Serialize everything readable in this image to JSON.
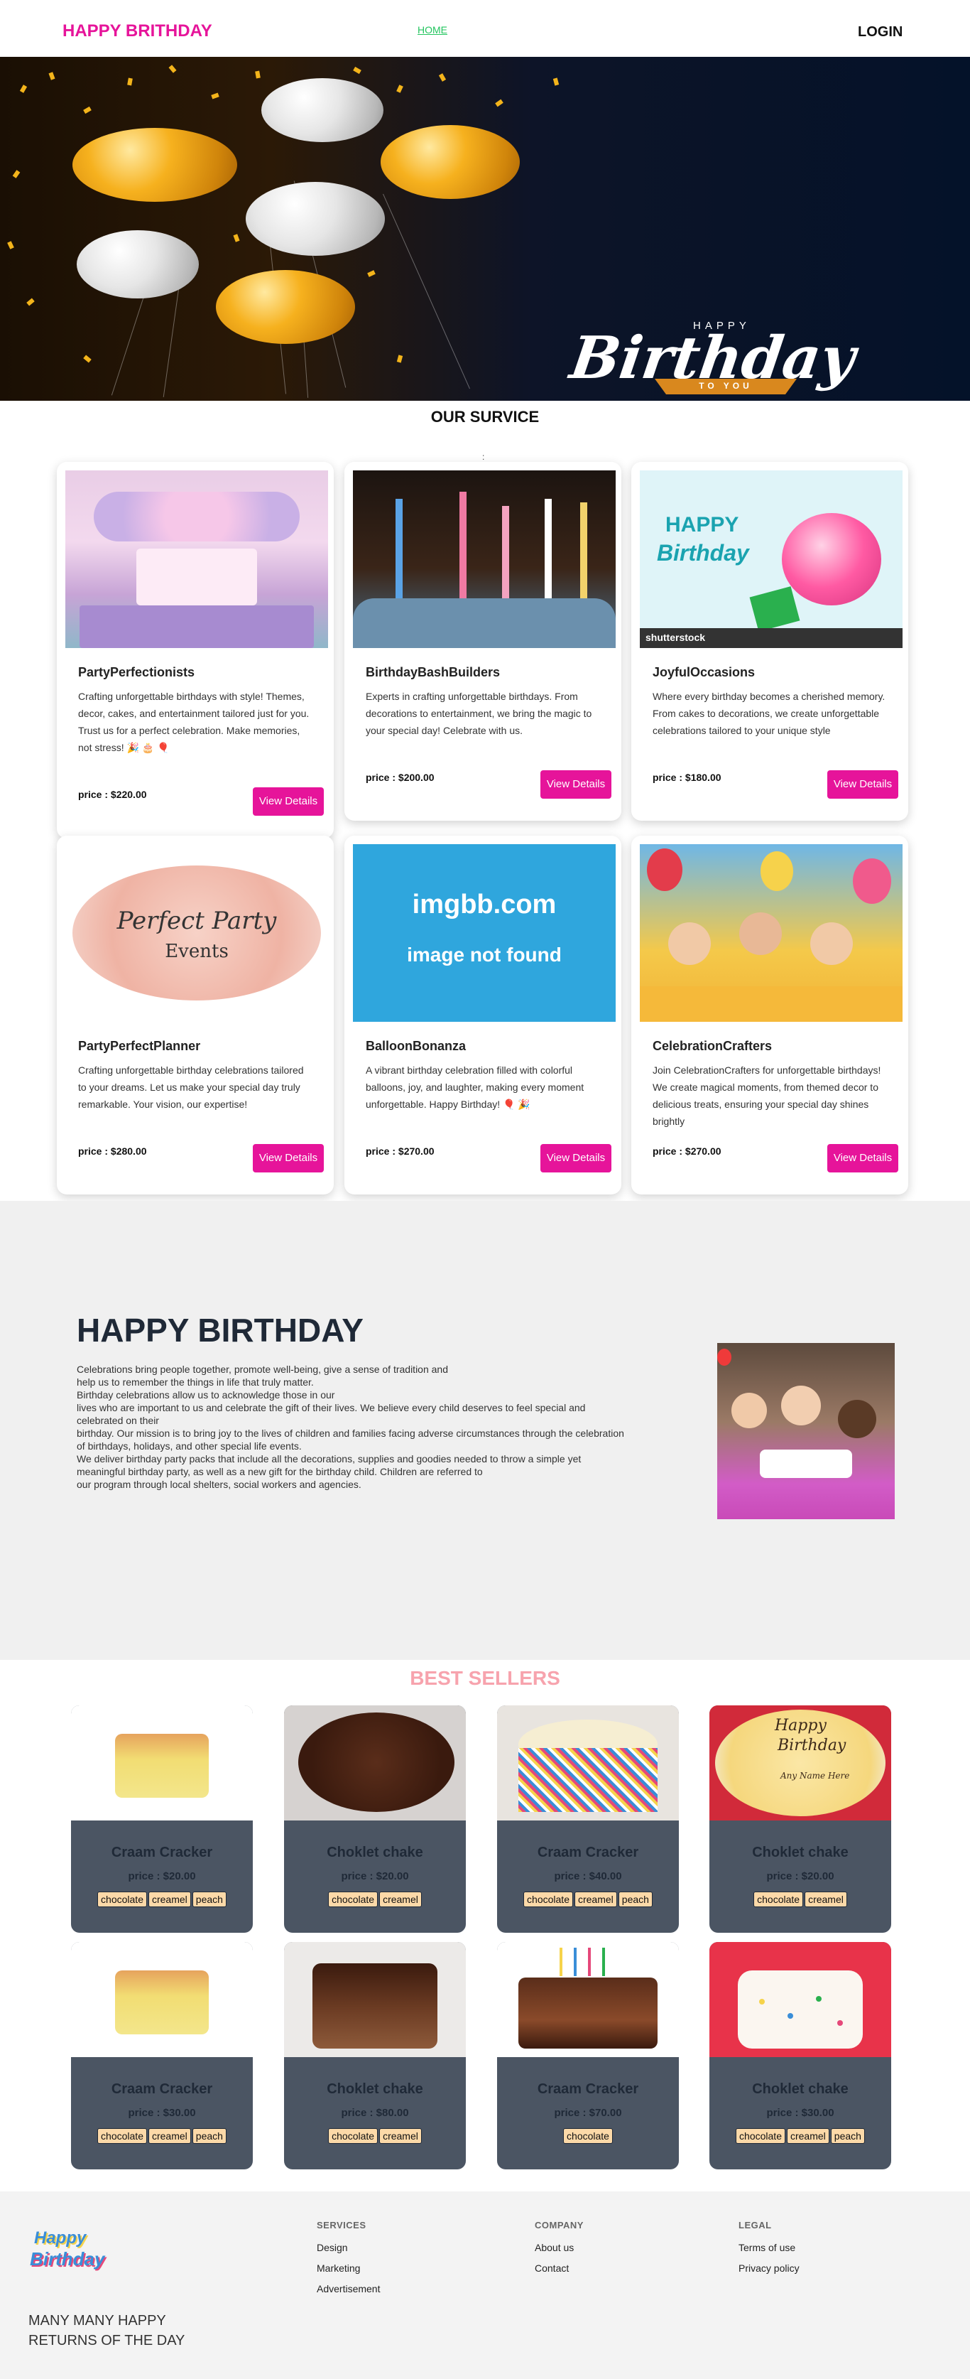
{
  "nav": {
    "brand": "HAPPY BRITHDAY",
    "home": "HOME",
    "login": "LOGIN"
  },
  "hero": {
    "happy": "HAPPY",
    "script": "Birthday",
    "to_you": "TO YOU"
  },
  "services": {
    "title": "OUR SURVICE",
    "dots": ":",
    "cards": [
      {
        "title": "PartyPerfectionists",
        "desc": "Crafting unforgettable birthdays with style! Themes, decor, cakes, and entertainment tailored just for you. Trust us for a perfect celebration. Make memories, not stress! 🎉 🎂 🎈",
        "price": "price : $220.00",
        "button": "View Details"
      },
      {
        "title": "BirthdayBashBuilders",
        "desc": "Experts in crafting unforgettable birthdays. From decorations to entertainment, we bring the magic to your special day! Celebrate with us.",
        "price": "price : $200.00",
        "button": "View Details"
      },
      {
        "title": "JoyfulOccasions",
        "desc": "Where every birthday becomes a cherished memory. From cakes to decorations, we create unforgettable celebrations tailored to your unique style",
        "price": "price : $180.00",
        "button": "View Details"
      },
      {
        "title": "PartyPerfectPlanner",
        "desc": "Crafting unforgettable birthday celebrations tailored to your dreams. Let us make your special day truly remarkable. Your vision, our expertise!",
        "price": "price : $280.00",
        "button": "View Details"
      },
      {
        "title": "BalloonBonanza",
        "desc": "A vibrant birthday celebration filled with colorful balloons, joy, and laughter, making every moment unforgettable. Happy Birthday! 🎈 🎉",
        "price": "price : $270.00",
        "button": "View Details"
      },
      {
        "title": "CelebrationCrafters",
        "desc": "Join CelebrationCrafters for unforgettable birthdays! We create magical moments, from themed decor to delicious treats, ensuring your special day shines brightly",
        "price": "price : $270.00",
        "button": "View Details"
      }
    ],
    "img_texts": {
      "perfect_party": "Perfect Party",
      "events": "Events",
      "imgbb": "imgbb.com",
      "not_found": "image not found",
      "happy": "HAPPY",
      "birthday": "Birthday",
      "shutterstock": "shutterstock"
    }
  },
  "about": {
    "heading": "HAPPY BIRTHDAY",
    "lines": [
      "Celebrations bring people together, promote well-being, give a sense of tradition and",
      "help us to remember the things in life that truly matter.",
      "Birthday celebrations allow us to acknowledge those in our",
      "lives who are important to us and celebrate the gift of their lives. We believe every child deserves to feel special and",
      "celebrated on their",
      "birthday. Our mission is to bring joy to the lives of children and families facing adverse circumstances through the celebration",
      "of birthdays, holidays, and other special life events.",
      "We deliver birthday party packs that include all the decorations, supplies and goodies needed to throw a simple yet",
      "meaningful birthday party, as well as a new gift for the birthday child. Children are referred to",
      "our program through local shelters, social workers and agencies."
    ]
  },
  "best_sellers": {
    "title": "BEST SELLERS",
    "items": [
      {
        "name": "Craam Cracker",
        "price": "price : $20.00",
        "tags": [
          "chocolate",
          "creamel",
          "peach"
        ]
      },
      {
        "name": "Choklet chake",
        "price": "price : $20.00",
        "tags": [
          "chocolate",
          "creamel"
        ]
      },
      {
        "name": "Craam Cracker",
        "price": "price : $40.00",
        "tags": [
          "chocolate",
          "creamel",
          "peach"
        ]
      },
      {
        "name": "Choklet chake",
        "price": "price : $20.00",
        "tags": [
          "chocolate",
          "creamel"
        ]
      },
      {
        "name": "Craam Cracker",
        "price": "price : $30.00",
        "tags": [
          "chocolate",
          "creamel",
          "peach"
        ]
      },
      {
        "name": "Choklet chake",
        "price": "price : $80.00",
        "tags": [
          "chocolate",
          "creamel"
        ]
      },
      {
        "name": "Craam Cracker",
        "price": "price : $70.00",
        "tags": [
          "chocolate"
        ]
      },
      {
        "name": "Choklet chake",
        "price": "price : $30.00",
        "tags": [
          "chocolate",
          "creamel",
          "peach"
        ]
      }
    ],
    "cake_text": {
      "happy": "Happy",
      "birthday": "Birthday",
      "any_name": "Any Name Here"
    }
  },
  "footer": {
    "logo_line1": "Happy",
    "logo_line2": "Birthday",
    "tagline": "MANY MANY HAPPY RETURNS OF THE DAY",
    "columns": [
      {
        "heading": "SERVICES",
        "links": [
          "Design",
          "Marketing",
          "Advertisement"
        ]
      },
      {
        "heading": "COMPANY",
        "links": [
          "About us",
          "Contact"
        ]
      },
      {
        "heading": "LEGAL",
        "links": [
          "Terms of use",
          "Privacy policy"
        ]
      }
    ]
  },
  "colors": {
    "brand": "#e6149a",
    "button": "#e6149a",
    "best_sellers_title": "#f7a3ad",
    "seller_card": "#4b5563",
    "tag": "#fcd9a8",
    "about_bg": "#f0f0f0"
  }
}
